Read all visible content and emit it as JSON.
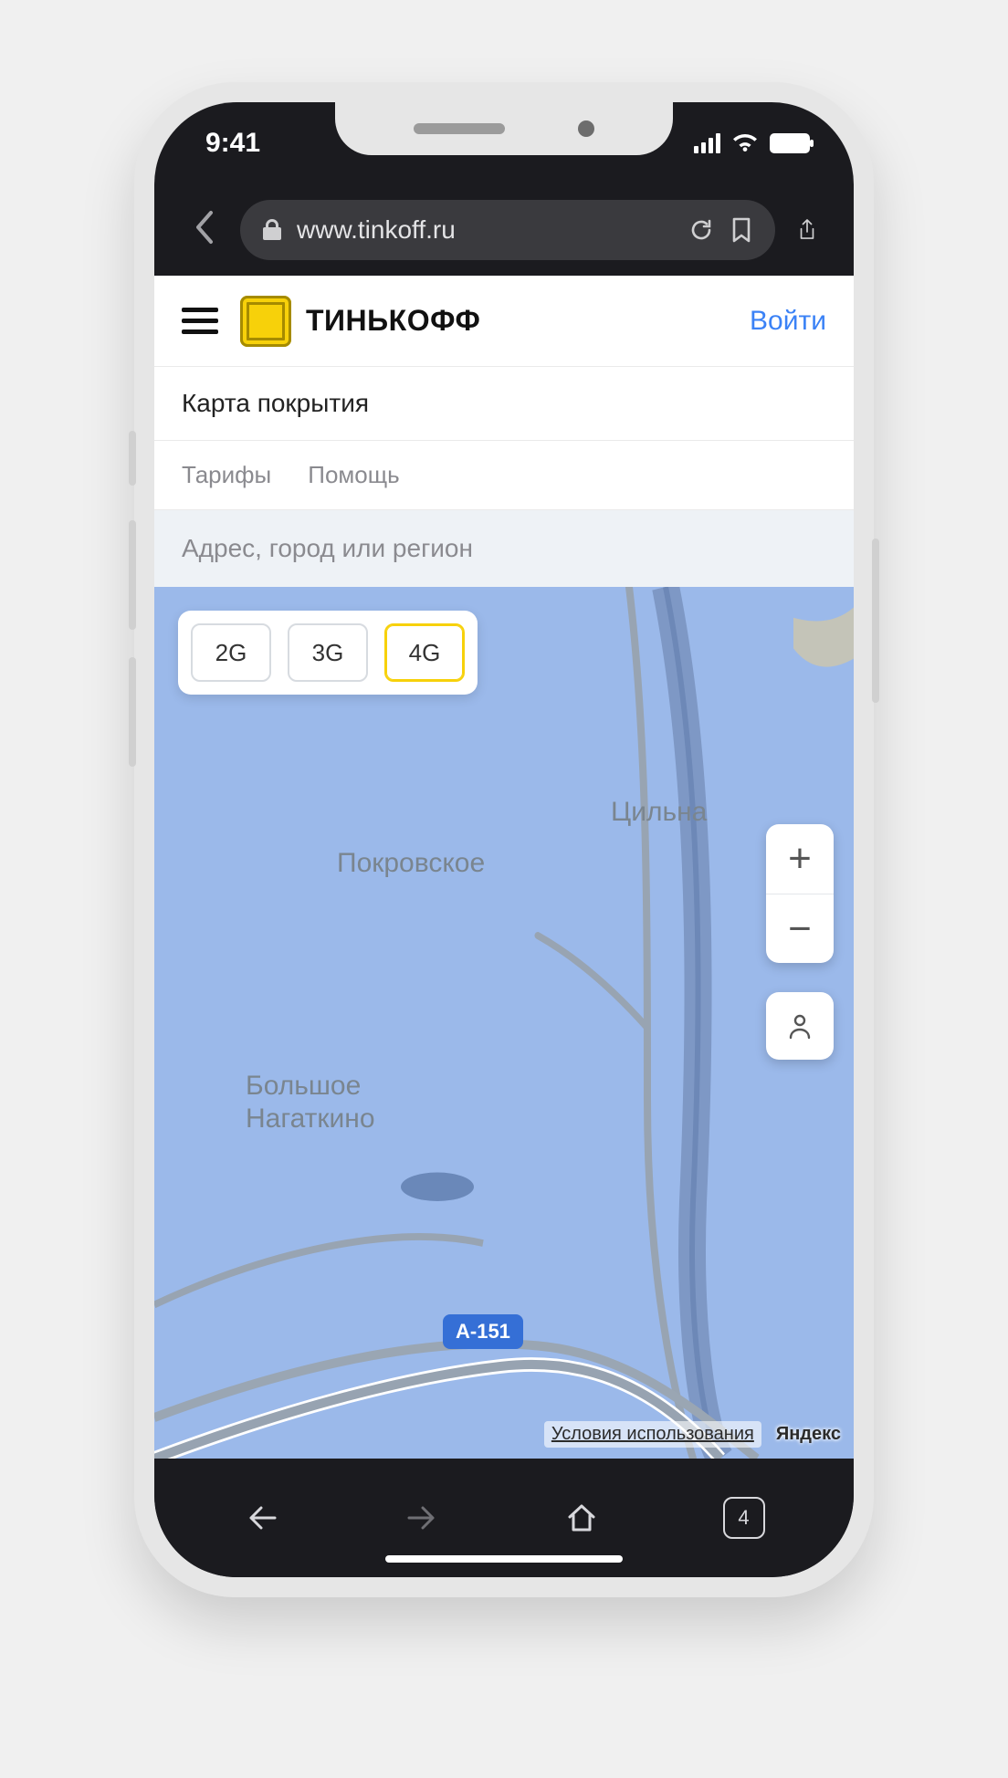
{
  "status": {
    "time": "9:41"
  },
  "browser": {
    "url": "www.tinkoff.ru",
    "tab_count": "4"
  },
  "header": {
    "brand": "ТИНЬКОФФ",
    "login": "Войти"
  },
  "page_title": "Карта покрытия",
  "tabs": {
    "tariffs": "Тарифы",
    "help": "Помощь"
  },
  "search": {
    "placeholder": "Адрес, город или регион"
  },
  "networks": {
    "g2": "2G",
    "g3": "3G",
    "g4": "4G",
    "active": "4G"
  },
  "map": {
    "labels": {
      "pokrovskoe": "Покровское",
      "tsilna": "Цильна",
      "nagatkino_l1": "Большое",
      "nagatkino_l2": "Нагаткино"
    },
    "route_badge": "А-151",
    "terms": "Условия использования",
    "attribution": "Яндекс"
  },
  "zoom": {
    "in": "+",
    "out": "−"
  }
}
